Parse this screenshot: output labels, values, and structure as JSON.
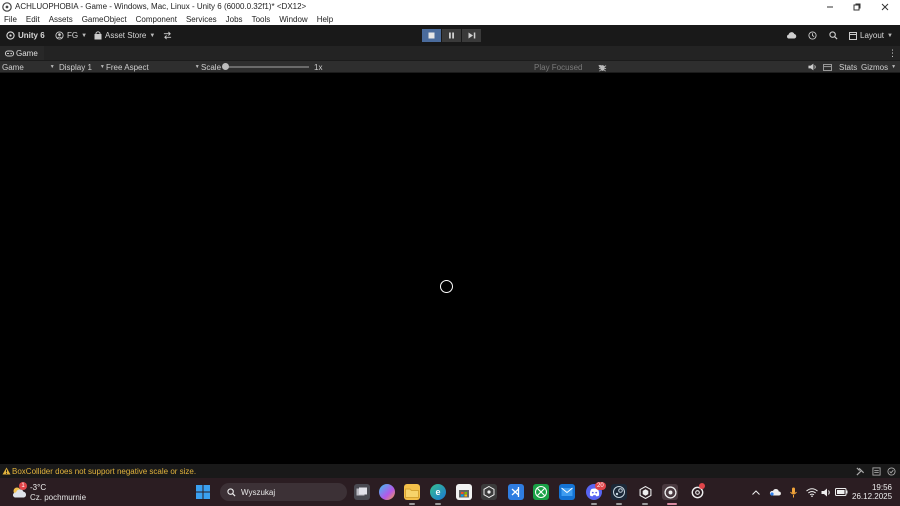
{
  "window": {
    "title": "ACHLUOPHOBIA - Game - Windows, Mac, Linux - Unity 6 (6000.0.32f1)* <DX12>",
    "controls": [
      "minimize-icon",
      "restore-icon",
      "close-icon"
    ]
  },
  "menu": [
    "File",
    "Edit",
    "Assets",
    "GameObject",
    "Component",
    "Services",
    "Jobs",
    "Tools",
    "Window",
    "Help"
  ],
  "toolbar": {
    "unity_label": "Unity 6",
    "account_label": "FG",
    "asset_store_label": "Asset Store",
    "layout_label": "Layout",
    "play_controls": [
      "play-icon",
      "pause-icon",
      "step-icon"
    ],
    "play_active": true
  },
  "game_tab": {
    "label": "Game"
  },
  "game_bar": {
    "mode": "Game",
    "display": "Display 1",
    "aspect": "Free Aspect",
    "scale_label": "Scale",
    "scale_value": "1x",
    "play_focused": "Play Focused",
    "stats": "Stats",
    "gizmos": "Gizmos"
  },
  "status": {
    "warning": "BoxCollider does not support negative scale or size."
  },
  "taskbar": {
    "weather_temp": "-3°C",
    "weather_desc": "Cz. pochmurnie",
    "weather_badge": "1",
    "search_placeholder": "Wyszukaj",
    "discord_badge": "20",
    "time": "19:56",
    "date": "26.12.2025"
  },
  "colors": {
    "accent_play": "#4a6b9c",
    "warning": "#e2b33c",
    "taskbar": "#2b1d22"
  }
}
